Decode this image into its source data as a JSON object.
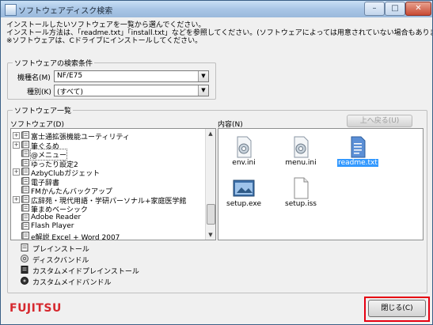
{
  "window": {
    "title": "ソフトウェアディスク検索",
    "controls": [
      "minimize",
      "maximize",
      "close"
    ]
  },
  "description": {
    "lines": [
      "インストールしたいソフトウェアを一覧から選んでください。",
      "インストール方法は、「readme.txt」「install.txt」などを参照してください。(ソフトウェアによっては用意されていない場合もあります)",
      "※ソフトウェアは、Cドライブにインストールしてください。"
    ]
  },
  "search": {
    "group_label": "ソフトウェアの検索条件",
    "model_label": "機種名(M)",
    "model_value": "NF/E75",
    "type_label": "種別(K)",
    "type_value": "(すべて)"
  },
  "software_list": {
    "group_label": "ソフトウェア一覧",
    "tree_label": "ソフトウェア(D)",
    "items": [
      {
        "label": "富士通拡張機能ユーティリティ",
        "expandable": true
      },
      {
        "label": "筆ぐるめ",
        "expandable": true
      },
      {
        "label": "@メニュー",
        "expandable": false,
        "selected": true
      },
      {
        "label": "ゆったり設定2",
        "expandable": false
      },
      {
        "label": "AzbyClubガジェット",
        "expandable": true
      },
      {
        "label": "電子辞書",
        "expandable": false
      },
      {
        "label": "FMかんたんバックアップ",
        "expandable": false
      },
      {
        "label": "広辞苑・現代用語・学研パーソナル+家庭医学館",
        "expandable": true
      },
      {
        "label": "筆まめベーシック",
        "expandable": false
      },
      {
        "label": "Adobe Reader",
        "expandable": false
      },
      {
        "label": "Flash Player",
        "expandable": false
      },
      {
        "label": "e解説 Excel + Word 2007",
        "expandable": false
      }
    ],
    "contents_label": "内容(N)",
    "up_button": "上へ戻る(U)",
    "files": [
      {
        "name": "env.ini",
        "icon": "settings-file-icon"
      },
      {
        "name": "menu.ini",
        "icon": "settings-file-icon"
      },
      {
        "name": "readme.txt",
        "icon": "text-file-icon",
        "selected": true
      },
      {
        "name": "setup.exe",
        "icon": "installer-icon"
      },
      {
        "name": "setup.iss",
        "icon": "document-icon"
      }
    ]
  },
  "legend": [
    {
      "label": "プレインストール",
      "icon": "preinstall-icon"
    },
    {
      "label": "ディスクバンドル",
      "icon": "disc-bundle-icon"
    },
    {
      "label": "カスタムメイドプレインストール",
      "icon": "custom-preinstall-icon"
    },
    {
      "label": "カスタムメイドバンドル",
      "icon": "custom-bundle-icon"
    }
  ],
  "footer": {
    "logo": "FUJITSU",
    "close_button": "閉じる(C)"
  },
  "colors": {
    "highlight": "#e60012",
    "brand": "#d6282e",
    "selection": "#3399ff"
  }
}
